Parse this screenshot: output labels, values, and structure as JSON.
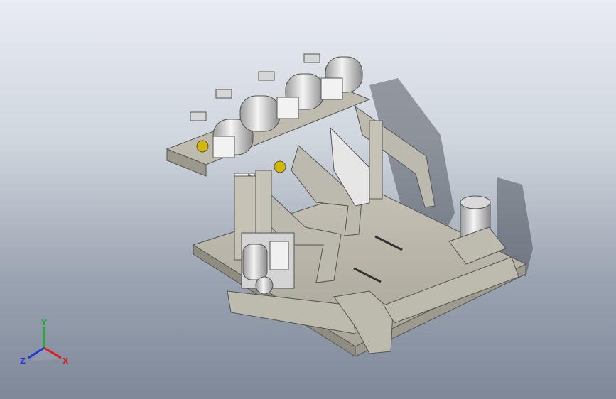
{
  "viewport": {
    "background_top": "#e9ecf1",
    "background_bottom": "#7f8899"
  },
  "triad": {
    "x_label": "X",
    "y_label": "Y",
    "z_label": "Z",
    "x_color": "#d81e1e",
    "y_color": "#1fae2b",
    "z_color": "#2438d8"
  },
  "model": {
    "base_color": "#b9b6a9",
    "metal_color": "#c9c9c9",
    "accent_color": "#d2b800"
  }
}
